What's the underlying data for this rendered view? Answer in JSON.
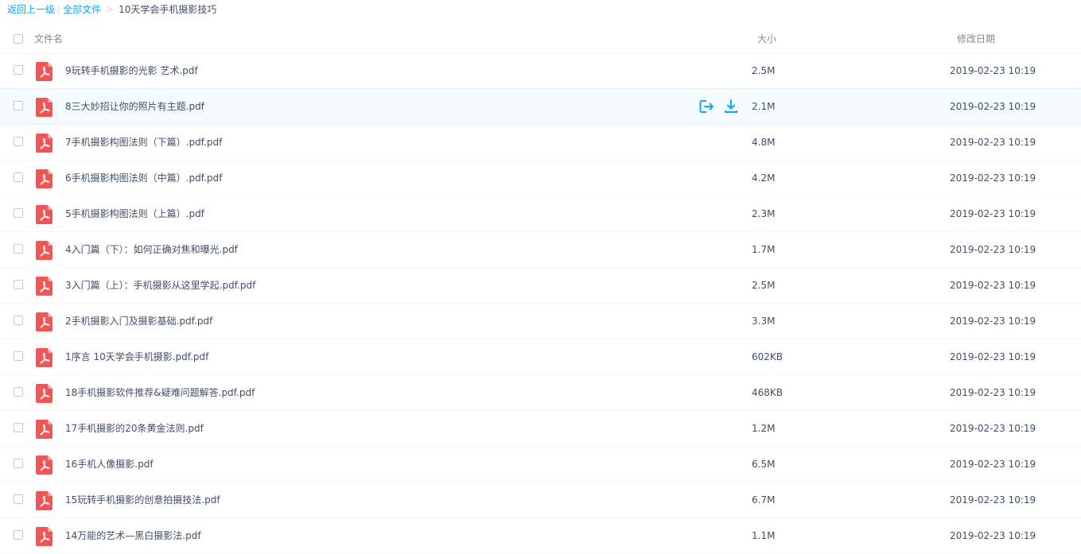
{
  "breadcrumb": {
    "back": "返回上一级",
    "all_files": "全部文件",
    "separator": ">",
    "current": "10天学会手机摄影技巧"
  },
  "header": {
    "name": "文件名",
    "size": "大小",
    "modified": "修改日期"
  },
  "colors": {
    "link": "#09aaff",
    "pdf_icon": "#f45454",
    "hover_row": "#f4fbff"
  },
  "files": [
    {
      "name": "9玩转手机摄影的光影 艺术.pdf",
      "size": "2.5M",
      "date": "2019-02-23 10:19",
      "icon": "pdf-icon"
    },
    {
      "name": "8三大妙招让你的照片有主题.pdf",
      "size": "2.1M",
      "date": "2019-02-23 10:19",
      "icon": "pdf-icon",
      "hovered": true
    },
    {
      "name": "7手机摄影构图法则（下篇）.pdf.pdf",
      "size": "4.8M",
      "date": "2019-02-23 10:19",
      "icon": "pdf-icon"
    },
    {
      "name": "6手机摄影构图法则（中篇）.pdf.pdf",
      "size": "4.2M",
      "date": "2019-02-23 10:19",
      "icon": "pdf-icon"
    },
    {
      "name": "5手机摄影构图法则（上篇）.pdf",
      "size": "2.3M",
      "date": "2019-02-23 10:19",
      "icon": "pdf-icon"
    },
    {
      "name": "4入门篇（下）：如何正确对焦和曝光.pdf",
      "size": "1.7M",
      "date": "2019-02-23 10:19",
      "icon": "pdf-icon"
    },
    {
      "name": "3入门篇（上）：手机摄影从这里学起.pdf.pdf",
      "size": "2.5M",
      "date": "2019-02-23 10:19",
      "icon": "pdf-icon"
    },
    {
      "name": "2手机摄影入门及摄影基础.pdf.pdf",
      "size": "3.3M",
      "date": "2019-02-23 10:19",
      "icon": "pdf-icon"
    },
    {
      "name": "1序言 10天学会手机摄影.pdf.pdf",
      "size": "602KB",
      "date": "2019-02-23 10:19",
      "icon": "pdf-icon"
    },
    {
      "name": "18手机摄影软件推荐&疑难问题解答.pdf.pdf",
      "size": "468KB",
      "date": "2019-02-23 10:19",
      "icon": "pdf-icon"
    },
    {
      "name": "17手机摄影的20条黄金法则.pdf",
      "size": "1.2M",
      "date": "2019-02-23 10:19",
      "icon": "pdf-icon"
    },
    {
      "name": "16手机人像摄影.pdf",
      "size": "6.5M",
      "date": "2019-02-23 10:19",
      "icon": "pdf-icon"
    },
    {
      "name": "15玩转手机摄影的创意拍摄技法.pdf",
      "size": "6.7M",
      "date": "2019-02-23 10:19",
      "icon": "pdf-icon"
    },
    {
      "name": "14万能的艺术—黑白摄影法.pdf",
      "size": "1.1M",
      "date": "2019-02-23 10:19",
      "icon": "pdf-icon"
    }
  ],
  "row_actions": {
    "share_icon": "share-icon",
    "download_icon": "download-icon"
  }
}
